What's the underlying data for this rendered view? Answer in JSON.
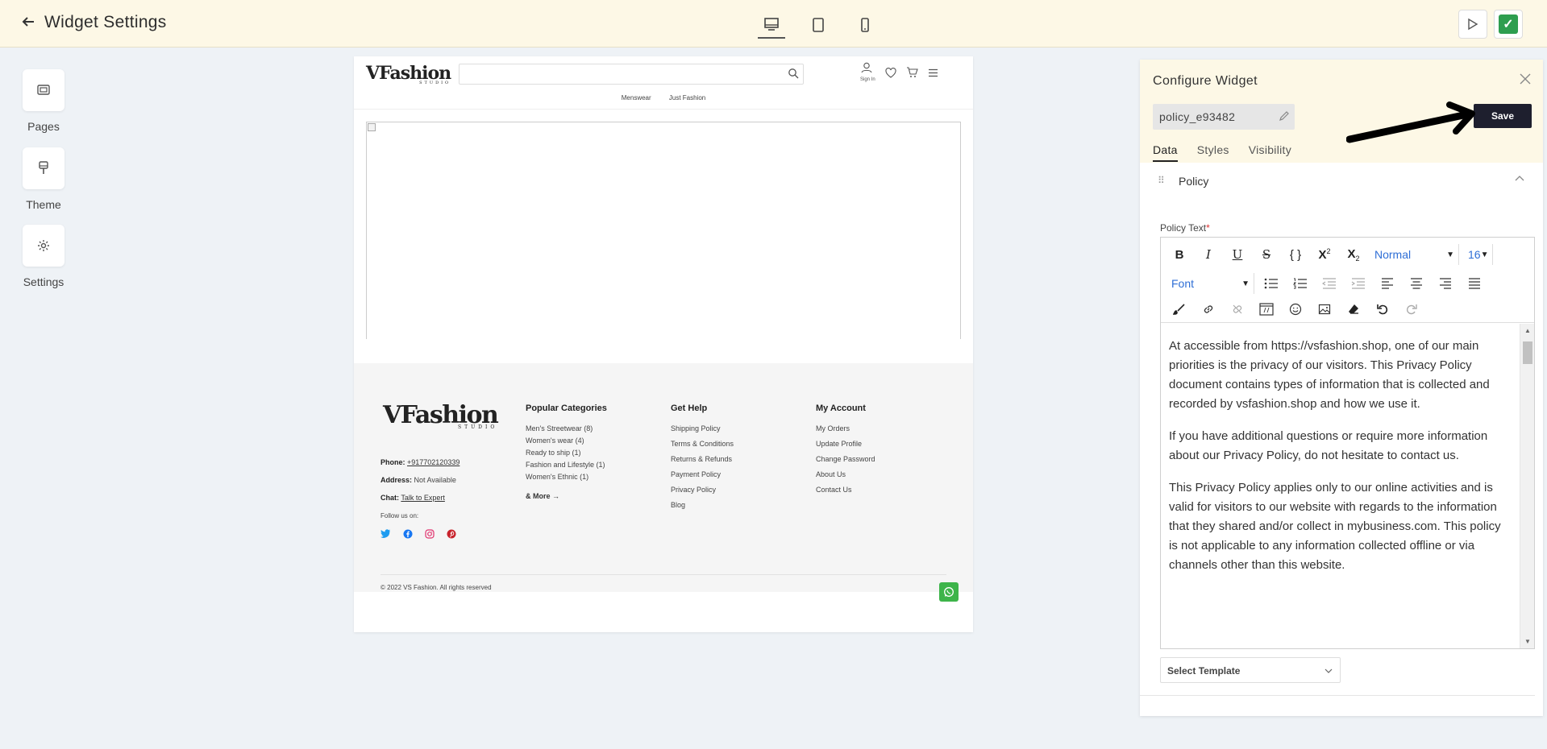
{
  "header": {
    "back_icon": "arrow-left-icon",
    "title": "Widget Settings",
    "devices": [
      "desktop-icon",
      "tablet-icon",
      "mobile-icon"
    ]
  },
  "sidebar": {
    "items": [
      {
        "label": "Pages",
        "icon": "pages-icon"
      },
      {
        "label": "Theme",
        "icon": "theme-icon"
      },
      {
        "label": "Settings",
        "icon": "gear-icon"
      }
    ]
  },
  "preview": {
    "sign_in": "Sign In",
    "nav": [
      "Menswear",
      "Just Fashion"
    ],
    "footer": {
      "contact": {
        "phone_label": "Phone:",
        "phone": "+917702120339",
        "address_label": "Address:",
        "address": "Not Available",
        "chat_label": "Chat:",
        "chat": "Talk to Expert"
      },
      "follow": "Follow us on:",
      "columns": [
        {
          "title": "Popular Categories",
          "items": [
            "Men's Streetwear (8)",
            "Women's wear (4)",
            "Ready to ship (1)",
            "Fashion and Lifestyle (1)",
            "Women's Ethnic (1)"
          ],
          "more": "& More"
        },
        {
          "title": "Get Help",
          "items": [
            "Shipping Policy",
            "Terms & Conditions",
            "Returns & Refunds",
            "Payment Policy",
            "Privacy Policy",
            "Blog"
          ]
        },
        {
          "title": "My Account",
          "items": [
            "My Orders",
            "Update Profile",
            "Change Password",
            "About Us",
            "Contact Us"
          ]
        }
      ],
      "copyright": "© 2022 VS Fashion. All rights reserved"
    }
  },
  "panel": {
    "title": "Configure Widget",
    "widget_name": "policy_e93482",
    "save_label": "Save",
    "tabs": [
      "Data",
      "Styles",
      "Visibility"
    ],
    "active_tab": "Data",
    "accordion_title": "Policy",
    "field_label": "Policy Text",
    "required_mark": "*",
    "toolbar": {
      "format": "Normal",
      "size": "16",
      "font": "Font"
    },
    "content": [
      "At  accessible from https://vsfashion.shop, one of our main priorities is the privacy of our visitors. This Privacy Policy document contains types of information that is collected and recorded by vsfashion.shop and how we use it.",
      "If you have additional questions or require more information about our Privacy Policy, do not hesitate to contact us.",
      "This Privacy Policy applies only to our online activities and is valid for visitors to our website with regards to the information that they shared and/or collect in mybusiness.com. This policy is not applicable to any information collected offline or via channels other than this website."
    ],
    "template_select": "Select Template"
  },
  "colors": {
    "header_bg": "#fdf8e6",
    "save_bg": "#1e1f2e",
    "check_green": "#2e9e4f",
    "whatsapp_green": "#3db44a",
    "link_blue": "#2f6fd6"
  }
}
